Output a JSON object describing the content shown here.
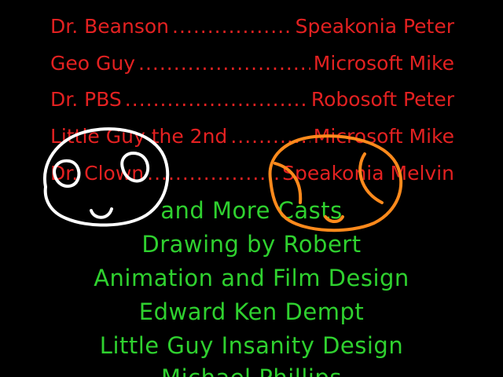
{
  "cast": [
    {
      "role": "Dr. Beanson",
      "actor": "Speakonia Peter"
    },
    {
      "role": "Geo Guy",
      "actor": "Microsoft Mike"
    },
    {
      "role": "Dr. PBS",
      "actor": "Robosoft Peter"
    },
    {
      "role": "Little Guy the 2nd",
      "actor": "Microsoft Mike"
    },
    {
      "role": "Dr. Clown",
      "actor": "Speakonia Melvin"
    }
  ],
  "credits": [
    "and More Casts",
    "Drawing by Robert",
    "Animation and Film Design",
    "Edward Ken Dempt",
    "Little Guy Insanity Design",
    "Michael Phillips"
  ],
  "colors": {
    "background": "#000000",
    "cast_text": "#e32121",
    "credit_text": "#2fd12f",
    "doodle_left": "#ffffff",
    "doodle_right": "#ff8a1c"
  }
}
